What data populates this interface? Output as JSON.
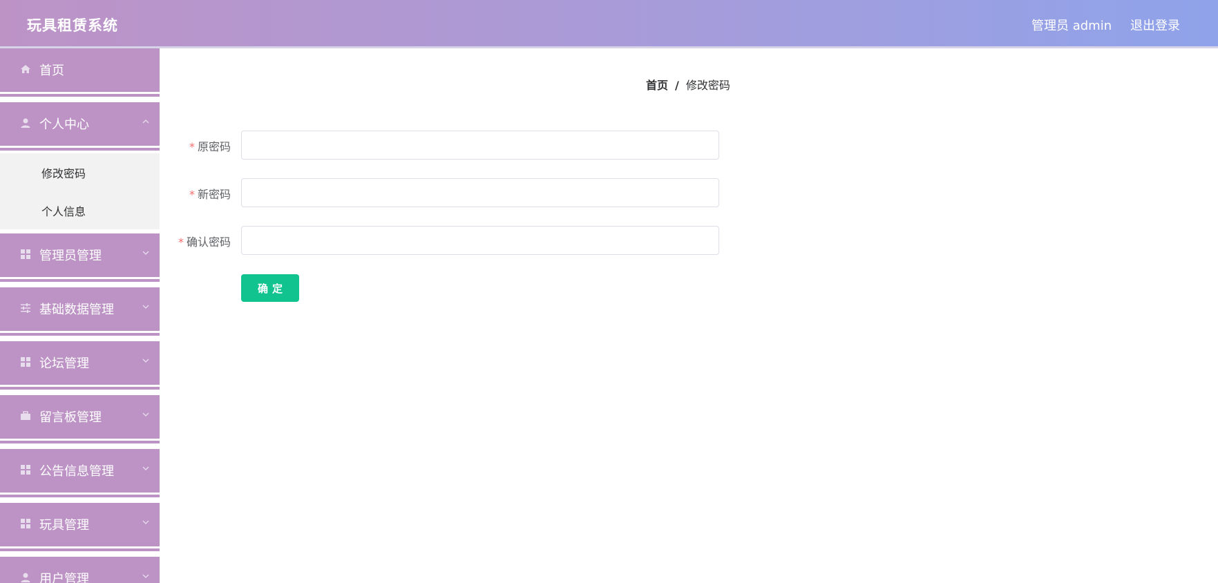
{
  "header": {
    "app_title": "玩具租赁系统",
    "user_label": "管理员 admin",
    "logout_label": "退出登录"
  },
  "sidebar": {
    "items": [
      {
        "label": "首页",
        "icon": "home-icon"
      },
      {
        "label": "个人中心",
        "icon": "user-icon"
      },
      {
        "label": "管理员管理",
        "icon": "grid-icon"
      },
      {
        "label": "基础数据管理",
        "icon": "sliders-icon"
      },
      {
        "label": "论坛管理",
        "icon": "grid-icon"
      },
      {
        "label": "留言板管理",
        "icon": "briefcase-icon"
      },
      {
        "label": "公告信息管理",
        "icon": "grid-icon"
      },
      {
        "label": "玩具管理",
        "icon": "grid-icon"
      },
      {
        "label": "用户管理",
        "icon": "user-icon"
      }
    ],
    "submenu": [
      {
        "label": "修改密码"
      },
      {
        "label": "个人信息"
      }
    ]
  },
  "breadcrumb": {
    "home": "首页",
    "separator": "/",
    "current": "修改密码"
  },
  "form": {
    "required_mark": "*",
    "fields": [
      {
        "label": "原密码",
        "value": ""
      },
      {
        "label": "新密码",
        "value": ""
      },
      {
        "label": "确认密码",
        "value": ""
      }
    ],
    "submit_label": "确定"
  },
  "colors": {
    "sidebar_bg": "#bd93c6",
    "header_gradient_start": "#bd93c6",
    "header_gradient_end": "#8fa3ea",
    "submit_button": "#10c38f",
    "required_mark": "#f56c6c"
  }
}
